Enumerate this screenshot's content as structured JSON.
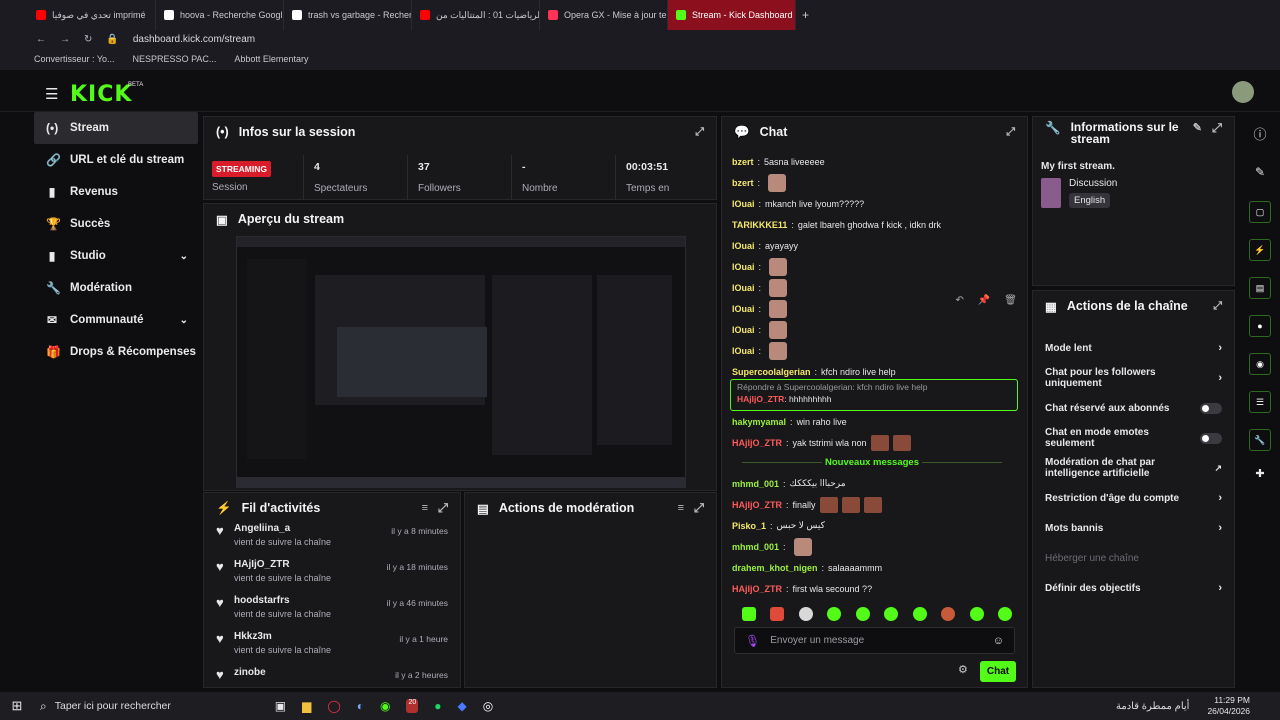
{
  "browser": {
    "tabs": [
      {
        "label": "تحدي في صوفيا imprimé",
        "color": "#ff0000"
      },
      {
        "label": "hoova - Recherche Googl",
        "color": "#ffffff"
      },
      {
        "label": "trash vs garbage - Recher",
        "color": "#ffffff"
      },
      {
        "label": "الرياضيات 01 : المتتاليات من",
        "color": "#ff0000"
      },
      {
        "label": "Opera GX - Mise à jour te",
        "color": "#ff3355"
      },
      {
        "label": "Stream - Kick Dashboard",
        "color": "#53fc18"
      }
    ],
    "url": "dashboard.kick.com/stream",
    "bookmarks": [
      "Convertisseur : Yo...",
      "NESPRESSO PAC...",
      "Abbott Elementary"
    ]
  },
  "app": {
    "logo": "KICK",
    "beta": "BETA"
  },
  "nav": [
    {
      "label": "Stream",
      "icon": "(•)"
    },
    {
      "label": "URL et clé du stream",
      "icon": "🔗"
    },
    {
      "label": "Revenus",
      "icon": "▮"
    },
    {
      "label": "Succès",
      "icon": "🏆"
    },
    {
      "label": "Studio",
      "icon": "▮"
    },
    {
      "label": "Modération",
      "icon": "🔧"
    },
    {
      "label": "Communauté",
      "icon": "✉"
    },
    {
      "label": "Drops & Récompenses",
      "icon": "🎁"
    }
  ],
  "session": {
    "title": "Infos sur la session",
    "badge": "STREAMING",
    "badge_label": "Session",
    "stats": [
      {
        "value": "4",
        "label": "Spectateurs"
      },
      {
        "value": "37",
        "label": "Followers"
      },
      {
        "value": "-",
        "label": "Nombre"
      },
      {
        "value": "00:03:51",
        "label": "Temps en"
      }
    ]
  },
  "preview": {
    "title": "Aperçu du stream"
  },
  "activity": {
    "title": "Fil d'activités",
    "items": [
      {
        "name": "Angeliina_a",
        "sub": "vient de suivre la chaîne",
        "time": "il y a 8 minutes"
      },
      {
        "name": "HAjIjO_ZTR",
        "sub": "vient de suivre la chaîne",
        "time": "il y a 18 minutes"
      },
      {
        "name": "hoodstarfrs",
        "sub": "vient de suivre la chaîne",
        "time": "il y a 46 minutes"
      },
      {
        "name": "Hkkz3m",
        "sub": "vient de suivre la chaîne",
        "time": "il y a 1 heure"
      },
      {
        "name": "zinobe",
        "sub": "",
        "time": "il y a 2 heures"
      }
    ]
  },
  "moderation": {
    "title": "Actions de modération"
  },
  "chat": {
    "title": "Chat",
    "lines": [
      {
        "user": "bzert",
        "color": "#f5e86a",
        "text": "5asna liveeeee",
        "emotes": 0
      },
      {
        "user": "bzert",
        "color": "#f5e86a",
        "text": "",
        "emotes": 1
      },
      {
        "user": "lOuai",
        "color": "#f5e86a",
        "text": "mkanch live lyoum?????",
        "emotes": 0
      },
      {
        "user": "TARIKKKE11",
        "color": "#f5e86a",
        "text": "galet lbareh ghodwa f kick , idkn drk",
        "emotes": 0
      },
      {
        "user": "lOuai",
        "color": "#f5e86a",
        "text": "ayayayy",
        "emotes": 0
      },
      {
        "user": "lOuai",
        "color": "#f5e86a",
        "text": "",
        "emotes": 1
      },
      {
        "user": "lOuai",
        "color": "#f5e86a",
        "text": "",
        "emotes": 1
      },
      {
        "user": "lOuai",
        "color": "#f5e86a",
        "text": "",
        "emotes": 1
      },
      {
        "user": "lOuai",
        "color": "#f5e86a",
        "text": "",
        "emotes": 1
      },
      {
        "user": "lOuai",
        "color": "#f5e86a",
        "text": "",
        "emotes": 1
      },
      {
        "user": "Supercoolalgerian",
        "color": "#f5e86a",
        "text": "kfch ndiro live help",
        "emotes": 0
      }
    ],
    "reply_to": "Répondre à Supercoolalgerian: kfch ndiro live help",
    "reply_user": "HAjIjO_ZTR",
    "reply_text": "hhhhhhhhh",
    "lines2": [
      {
        "user": "hakymyamal",
        "color": "#9bf03c",
        "text": "win raho live",
        "emotes": 0
      },
      {
        "user": "HAjIjO_ZTR",
        "color": "#ff5a5a",
        "text": "yak tstrimi wla non",
        "emotes": 2
      }
    ],
    "divider": "Nouveaux messages",
    "lines3": [
      {
        "user": "mhmd_001",
        "color": "#9bf03c",
        "text": "مرحبااا بيكككك",
        "emotes": 0
      },
      {
        "user": "HAjIjO_ZTR",
        "color": "#ff5a5a",
        "text": "finally",
        "emotes": 3
      },
      {
        "user": "Pisko_1",
        "color": "#f5e86a",
        "text": "كيس لا حبس",
        "emotes": 0
      },
      {
        "user": "mhmd_001",
        "color": "#9bf03c",
        "text": "",
        "emotes": 1
      },
      {
        "user": "drahem_khot_nigen",
        "color": "#9bf03c",
        "text": "salaaaammm",
        "emotes": 0
      },
      {
        "user": "HAjIjO_ZTR",
        "color": "#ff5a5a",
        "text": "first wla secound ??",
        "emotes": 0
      }
    ],
    "placeholder": "Envoyer un message",
    "send": "Chat"
  },
  "info": {
    "title": "Informations sur le stream",
    "stream_title": "My first stream.",
    "category": "Discussion",
    "language": "English"
  },
  "channel": {
    "title": "Actions de la chaîne",
    "items": [
      {
        "label": "Mode lent",
        "control": "chevron"
      },
      {
        "label": "Chat pour les followers uniquement",
        "control": "chevron"
      },
      {
        "label": "Chat réservé aux abonnés",
        "control": "toggle"
      },
      {
        "label": "Chat en mode emotes seulement",
        "control": "toggle"
      },
      {
        "label": "Modération de chat par intelligence artificielle",
        "control": "external"
      },
      {
        "label": "Restriction d'âge du compte",
        "control": "chevron"
      },
      {
        "label": "Mots bannis",
        "control": "chevron"
      },
      {
        "label": "Héberger une chaîne",
        "control": "none"
      },
      {
        "label": "Définir des objectifs",
        "control": "chevron"
      }
    ]
  },
  "taskbar": {
    "search": "Taper ici pour rechercher",
    "weather": "أيام ممطرة قادمة",
    "time": "11:29 PM",
    "date": "26/04/2026",
    "badge": "20"
  }
}
